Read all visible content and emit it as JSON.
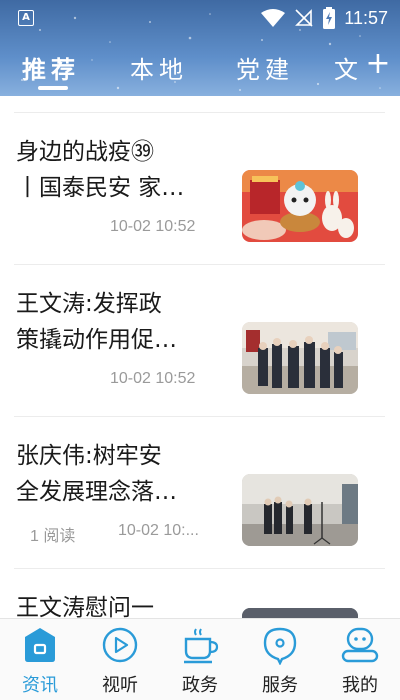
{
  "status_bar": {
    "time": "11:57",
    "app_badge": "A"
  },
  "tabs": [
    {
      "label": "推荐"
    },
    {
      "label": "本地"
    },
    {
      "label": "党建"
    },
    {
      "label": "文"
    }
  ],
  "add_tab_label": "+",
  "articles": [
    {
      "title": "身边的战疫㊴丨国泰民安 家和月圆",
      "title_display": "身边的战疫㊴\n丨国泰民安 家…",
      "reads": "",
      "date": "10-02 10:52"
    },
    {
      "title": "王文涛:发挥政策撬动作用促…",
      "title_display": "王文涛:发挥政\n策撬动作用促…",
      "reads": "",
      "date": "10-02 10:52"
    },
    {
      "title": "张庆伟:树牢安全发展理念落…",
      "title_display": "张庆伟:树牢安\n全发展理念落…",
      "reads": "1 阅读",
      "date": "10-02 10:..."
    },
    {
      "title": "王文涛慰问一",
      "title_display": "王文涛慰问一",
      "reads": "",
      "date": ""
    }
  ],
  "bottom_nav": [
    {
      "label": "资讯",
      "icon": "news-home-icon",
      "active": true
    },
    {
      "label": "视听",
      "icon": "play-icon",
      "active": false
    },
    {
      "label": "政务",
      "icon": "cup-icon",
      "active": false
    },
    {
      "label": "服务",
      "icon": "service-bubble-icon",
      "active": false
    },
    {
      "label": "我的",
      "icon": "profile-robot-icon",
      "active": false
    }
  ],
  "colors": {
    "accent": "#2a9bd8",
    "header_top": "#3f6aa3",
    "header_bottom": "#88b0de"
  }
}
